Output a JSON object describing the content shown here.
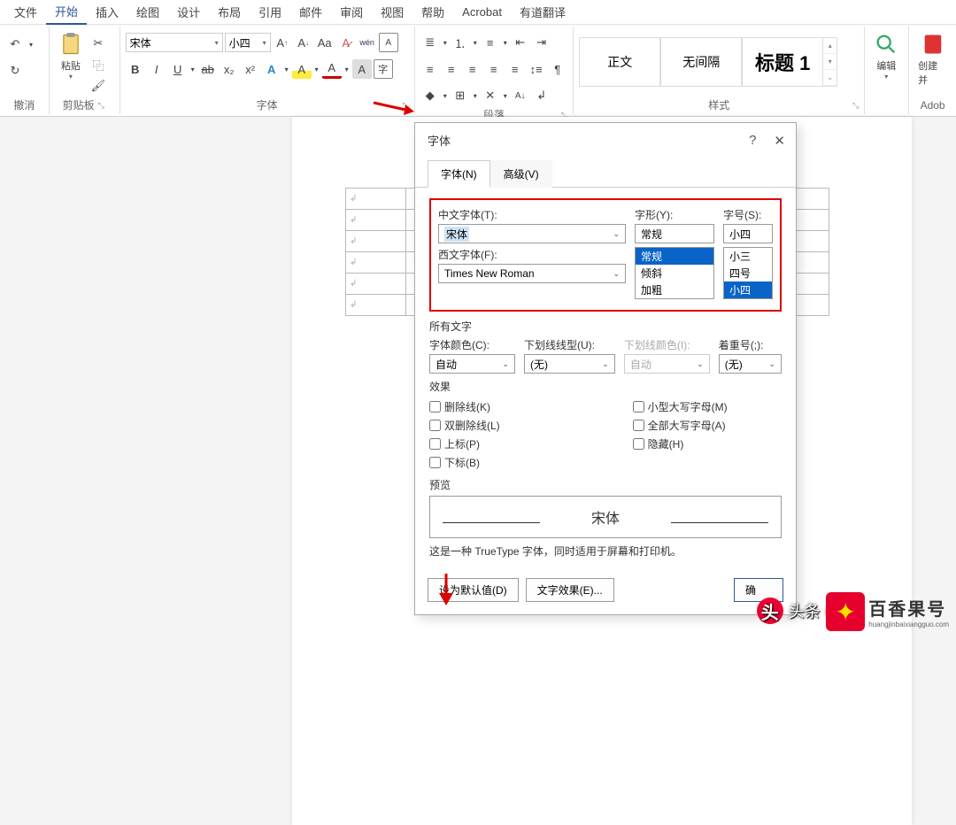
{
  "menu": {
    "file": "文件",
    "home": "开始",
    "insert": "插入",
    "draw": "绘图",
    "design": "设计",
    "layout": "布局",
    "references": "引用",
    "mail": "邮件",
    "review": "审阅",
    "view": "视图",
    "help": "帮助",
    "acrobat": "Acrobat",
    "youdao": "有道翻译"
  },
  "ribbon": {
    "undo_label": "撤消",
    "clipboard_label": "剪贴板",
    "paste_label": "粘贴",
    "font_label": "字体",
    "font_name": "宋体",
    "font_size": "小四",
    "paragraph_label": "段落",
    "styles_label": "样式",
    "style_normal": "正文",
    "style_nospace": "无间隔",
    "style_heading1": "标题 1",
    "edit_label": "编辑",
    "adobe_label": "Adob",
    "create_label": "创建并"
  },
  "dialog": {
    "title": "字体",
    "help": "?",
    "close": "✕",
    "tab_font": "字体(N)",
    "tab_advanced": "高级(V)",
    "cn_font_label": "中文字体(T):",
    "cn_font_value": "宋体",
    "en_font_label": "西文字体(F):",
    "en_font_value": "Times New Roman",
    "style_label": "字形(Y):",
    "style_value": "常规",
    "style_opts": {
      "regular": "常规",
      "italic": "倾斜",
      "bold": "加粗"
    },
    "size_label": "字号(S):",
    "size_value": "小四",
    "size_opts": {
      "s1": "小三",
      "s2": "四号",
      "s3": "小四"
    },
    "all_text": "所有文字",
    "color_label": "字体颜色(C):",
    "color_value": "自动",
    "ul_style_label": "下划线线型(U):",
    "ul_style_value": "(无)",
    "ul_color_label": "下划线颜色(I):",
    "ul_color_value": "自动",
    "emphasis_label": "着重号(;):",
    "emphasis_value": "(无)",
    "effects": "效果",
    "chk_strike": "删除线(K)",
    "chk_dstrike": "双删除线(L)",
    "chk_sup": "上标(P)",
    "chk_sub": "下标(B)",
    "chk_smallcaps": "小型大写字母(M)",
    "chk_allcaps": "全部大写字母(A)",
    "chk_hidden": "隐藏(H)",
    "preview": "预览",
    "preview_text": "宋体",
    "preview_note": "这是一种 TrueType 字体，同时适用于屏幕和打印机。",
    "btn_default": "设为默认值(D)",
    "btn_effects": "文字效果(E)...",
    "btn_ok": "确",
    "btn_cancel": ""
  },
  "watermark": {
    "tou": "头条",
    "at": "@",
    "bxg": "百香果号",
    "domain": "huangjinbaixiangguo.com"
  }
}
